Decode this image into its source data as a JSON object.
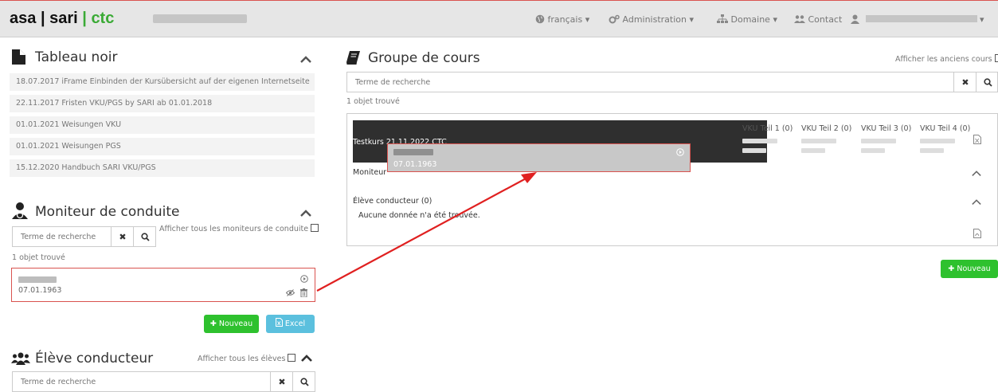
{
  "navbar": {
    "brand_asa": "asa",
    "brand_sep1": "|",
    "brand_sari": "sari",
    "brand_sep2": "|",
    "brand_ctc": "ctc",
    "language": "français",
    "administration": "Administration",
    "domaine": "Domaine",
    "contact": "Contact",
    "icons": [
      "globe-icon",
      "cogs-icon",
      "sitemap-icon",
      "users-icon",
      "user-icon",
      "caret-down-icon"
    ]
  },
  "tableau": {
    "title": "Tableau noir",
    "items": [
      "18.07.2017 iFrame Einbinden der Kursübersicht auf der eigenen Internetseite",
      "22.11.2017 Fristen VKU/PGS by SARI ab 01.01.2018",
      "01.01.2021 Weisungen VKU",
      "01.01.2021 Weisungen PGS",
      "15.12.2020 Handbuch SARI VKU/PGS"
    ]
  },
  "moniteur": {
    "title": "Moniteur de conduite",
    "search_placeholder": "Terme de recherche",
    "show_all": "Afficher tous les moniteurs de conduite",
    "found": "1 objet trouvé",
    "card_date": "07.01.1963",
    "btn_new": "Nouveau",
    "btn_excel": "Excel"
  },
  "eleve": {
    "title": "Élève conducteur",
    "show_all": "Afficher tous les élèves",
    "search_placeholder": "Terme de recherche"
  },
  "groupe": {
    "title": "Groupe de cours",
    "show_old": "Afficher les anciens cours",
    "search_placeholder": "Terme de recherche",
    "found": "1 objet trouvé",
    "course_name": "Testkurs 21.11.2022 CTC",
    "vku": [
      "VKU Teil 1 (0)",
      "VKU Teil 2 (0)",
      "VKU Teil 3 (0)",
      "VKU Teil 4 (0)"
    ],
    "moniteur_label": "Moniteur",
    "eleve_label": "Élève conducteur (0)",
    "no_data": "Aucune donnée n'a été trouvée.",
    "btn_new": "Nouveau"
  },
  "drag": {
    "date": "07.01.1963"
  },
  "colors": {
    "accent_red": "#d9534f",
    "green": "#2ec12e",
    "blue": "#5bc0de",
    "brand_green": "#3aaa35"
  }
}
